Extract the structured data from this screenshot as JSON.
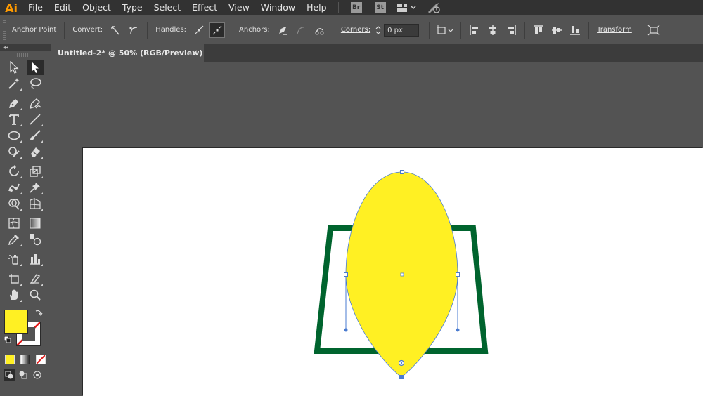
{
  "app": {
    "logo": "Ai"
  },
  "menu": [
    "File",
    "Edit",
    "Object",
    "Type",
    "Select",
    "Effect",
    "View",
    "Window",
    "Help"
  ],
  "menu_badges": [
    "Br",
    "St"
  ],
  "control_bar": {
    "tool_name": "Anchor Point",
    "convert_label": "Convert:",
    "handles_label": "Handles:",
    "anchors_label": "Anchors:",
    "corners_label": "Corners:",
    "corners_value": "0 px",
    "transform_label": "Transform"
  },
  "document_tab": {
    "title": "Untitled-2* @ 50% (RGB/Preview)",
    "close": "×"
  },
  "colors": {
    "fill": "#fff023",
    "frame_stroke": "#00642e",
    "selection": "#4a7bd0",
    "accent_logo": "#ff9a00"
  }
}
